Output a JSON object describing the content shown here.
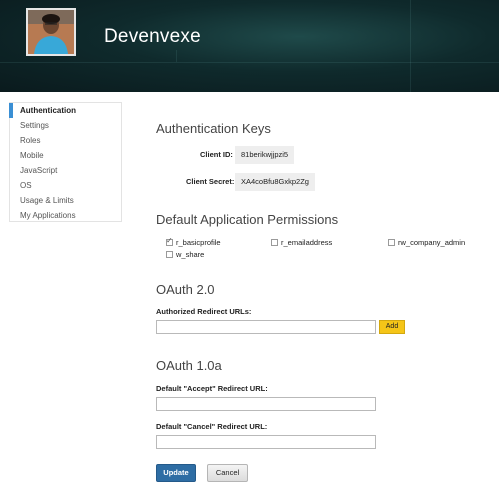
{
  "header": {
    "app_name": "Devenvexe",
    "avatar_icon": "user-avatar-photo"
  },
  "sidebar": {
    "items": [
      {
        "label": "Authentication",
        "active": true
      },
      {
        "label": "Settings",
        "active": false
      },
      {
        "label": "Roles",
        "active": false
      },
      {
        "label": "Mobile",
        "active": false
      },
      {
        "label": "JavaScript",
        "active": false
      },
      {
        "label": "OS",
        "active": false
      },
      {
        "label": "Usage & Limits",
        "active": false
      },
      {
        "label": "My Applications",
        "active": false
      }
    ],
    "accent_color": "#3a8fd4"
  },
  "auth_keys": {
    "title": "Authentication Keys",
    "client_id_label": "Client ID:",
    "client_id_value": "81berikwjjpzi5",
    "client_secret_label": "Client Secret:",
    "client_secret_value": "XA4coBfu8Gxkp2Zg"
  },
  "permissions": {
    "title": "Default Application Permissions",
    "items": [
      {
        "label": "r_basicprofile",
        "checked": true
      },
      {
        "label": "r_emailaddress",
        "checked": false
      },
      {
        "label": "rw_company_admin",
        "checked": false
      },
      {
        "label": "w_share",
        "checked": false
      }
    ]
  },
  "oauth2": {
    "title": "OAuth 2.0",
    "redirect_label": "Authorized Redirect URLs:",
    "redirect_value": "",
    "add_label": "Add"
  },
  "oauth1": {
    "title": "OAuth 1.0a",
    "accept_label": "Default \"Accept\" Redirect URL:",
    "accept_value": "",
    "cancel_label": "Default \"Cancel\" Redirect URL:",
    "cancel_value": ""
  },
  "actions": {
    "update_label": "Update",
    "cancel_label": "Cancel",
    "update_color": "#2e6da4",
    "add_color": "#f5c518"
  }
}
